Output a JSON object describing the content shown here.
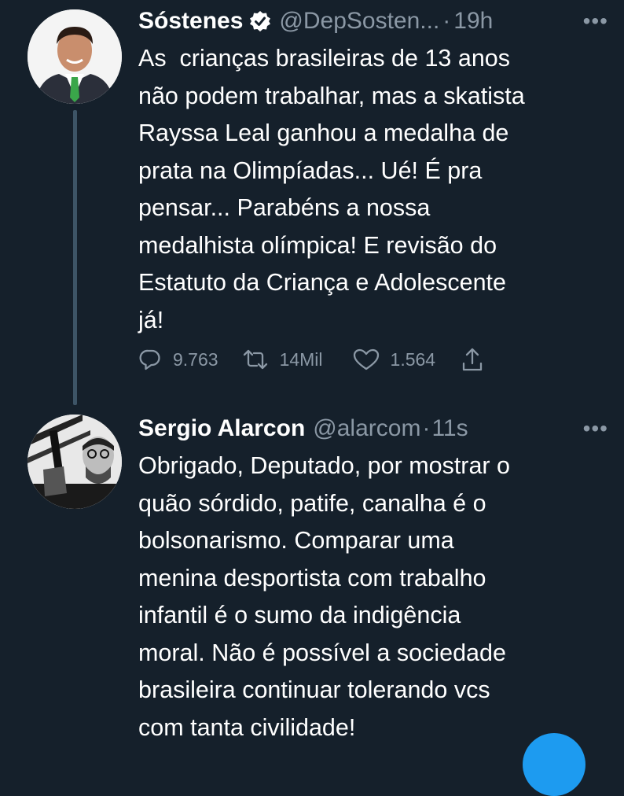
{
  "tweets": [
    {
      "author": "Sóstenes",
      "verified": true,
      "handle": "@DepSosten...",
      "time": "19h",
      "more_icon": "more-dots-icon",
      "text": "As  crianças brasileiras de 13 anos\nnão podem trabalhar, mas a skatista\nRayssa Leal ganhou a medalha de\nprata na Olimpíadas... Ué! É pra\npensar... Parabéns a nossa\nmedalhista olímpica! E revisão do\nEstatuto da Criança e Adolescente\njá!",
      "stats": {
        "replies": "9.763",
        "retweets": "14Mil",
        "likes": "1.564"
      }
    },
    {
      "author": "Sergio Alarcon",
      "verified": false,
      "handle": "@alarcom",
      "time": "11s",
      "more_icon": "more-dots-icon",
      "text": "Obrigado, Deputado, por mostrar o\nquão sórdido, patife, canalha é o\nbolsonarismo. Comparar uma\nmenina desportista com trabalho\ninfantil é o sumo da indigência\nmoral. Não é possível a sociedade\nbrasileira continuar tolerando vcs\ncom tanta civilidade!"
    }
  ],
  "colors": {
    "background": "#15202b",
    "secondary_text": "#8b98a5",
    "accent": "#1d9bf0"
  }
}
